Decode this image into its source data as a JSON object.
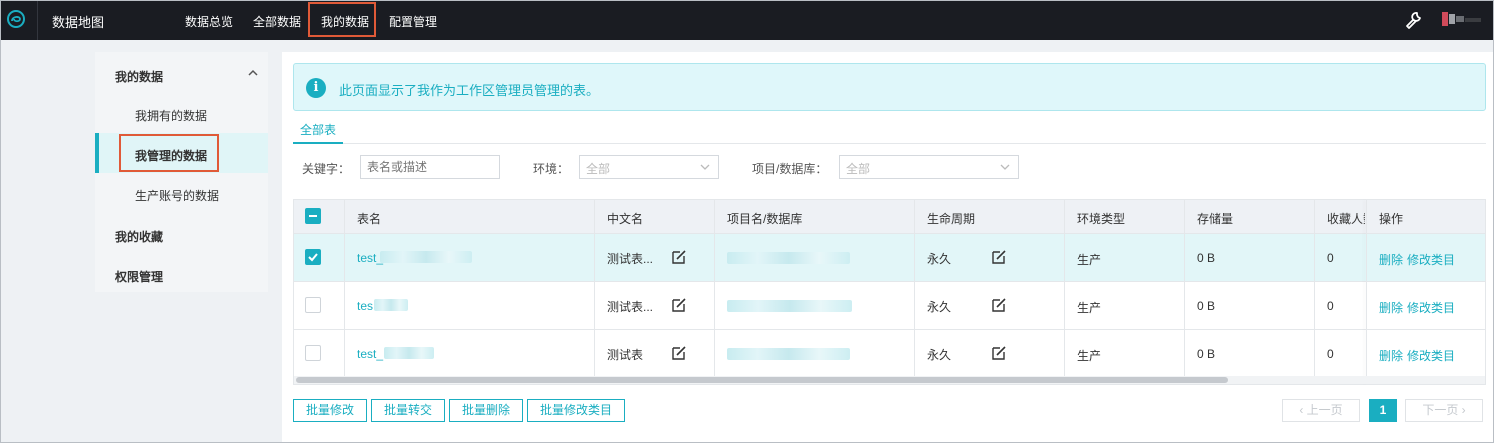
{
  "topbar": {
    "app_title": "数据地图",
    "nav": [
      "数据总览",
      "全部数据",
      "我的数据",
      "配置管理"
    ]
  },
  "sidebar": {
    "group_my_data": "我的数据",
    "items": [
      "我拥有的数据",
      "我管理的数据",
      "生产账号的数据"
    ],
    "group_favorites": "我的收藏",
    "group_permissions": "权限管理"
  },
  "info": {
    "text": "此页面显示了我作为工作区管理员管理的表。"
  },
  "tabs": {
    "all_tables": "全部表"
  },
  "filters": {
    "keyword_label": "关键字：",
    "keyword_placeholder": "表名或描述",
    "env_label": "环境：",
    "env_value": "全部",
    "project_label": "项目/数据库：",
    "project_value": "全部"
  },
  "table": {
    "headers": [
      "表名",
      "中文名",
      "项目名/数据库",
      "生命周期",
      "环境类型",
      "存储量",
      "收藏人数",
      "操作"
    ],
    "rows": [
      {
        "name": "test_",
        "cn_name": "测试表...",
        "lifecycle": "永久",
        "env": "生产",
        "storage": "0 B",
        "favorites": "0",
        "actions": [
          "删除",
          "修改类目"
        ],
        "selected": true
      },
      {
        "name": "tes",
        "cn_name": "测试表...",
        "lifecycle": "永久",
        "env": "生产",
        "storage": "0 B",
        "favorites": "0",
        "actions": [
          "删除",
          "修改类目"
        ],
        "selected": false
      },
      {
        "name": "test_",
        "cn_name": "测试表",
        "lifecycle": "永久",
        "env": "生产",
        "storage": "0 B",
        "favorites": "0",
        "actions": [
          "删除",
          "修改类目"
        ],
        "selected": false
      }
    ]
  },
  "bulk_actions": [
    "批量修改",
    "批量转交",
    "批量删除",
    "批量修改类目"
  ],
  "pager": {
    "prev": "上一页",
    "current": "1",
    "next": "下一页"
  },
  "colors": {
    "accent": "#1aaec1",
    "highlight": "#e05a38",
    "topbar": "#1a1c22"
  }
}
